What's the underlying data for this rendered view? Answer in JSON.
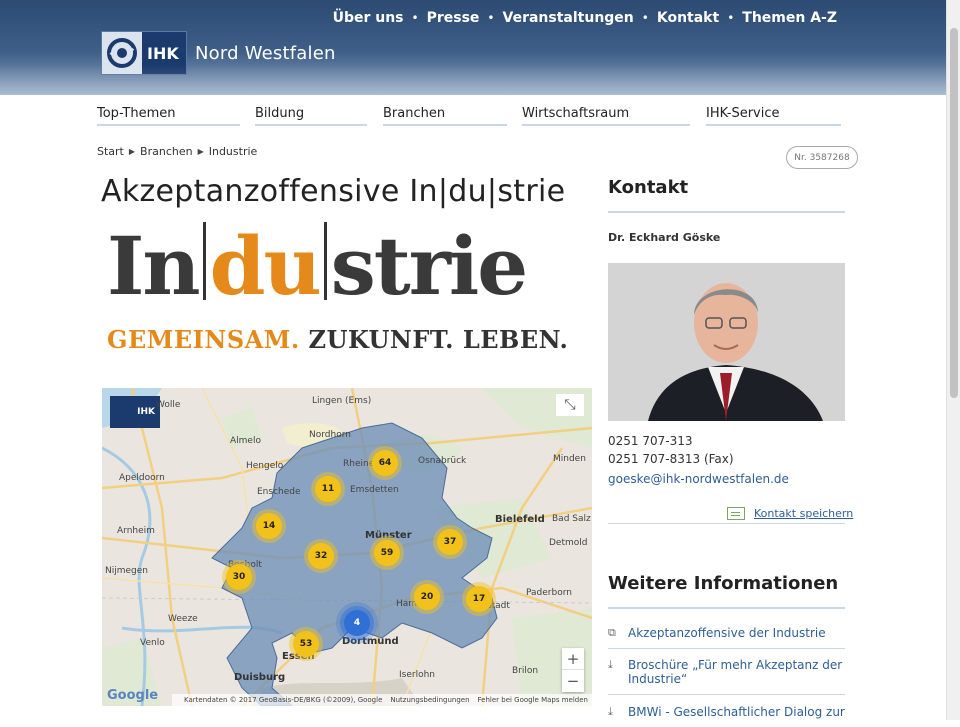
{
  "header": {
    "logo_text": "IHK",
    "org_name": "Nord Westfalen",
    "top_nav": [
      "Über uns",
      "Presse",
      "Veranstaltungen",
      "Kontakt",
      "Themen A-Z"
    ]
  },
  "main_nav": [
    "Top-Themen",
    "Bildung",
    "Branchen",
    "Wirtschaftsraum",
    "IHK-Service"
  ],
  "breadcrumb": [
    "Start",
    "Branchen",
    "Industrie"
  ],
  "page_number": "Nr. 3587268",
  "page_title": "Akzeptanzoffensive In|du|strie",
  "banner": {
    "word_part1": "In",
    "word_part2": "du",
    "word_part3": "strie",
    "slogan_part1": "GEMEINSAM.",
    "slogan_part2": "ZUKUNFT. LEBEN."
  },
  "map": {
    "logo": "IHK",
    "places": [
      "Lingen (Ems)",
      "Nordhorn",
      "Almelo",
      "Hengelo",
      "Apeldoorn",
      "Enschede",
      "Rheine",
      "Osnabrück",
      "Emsdetten",
      "Minden",
      "Arnheim",
      "Bielefeld",
      "Bad Salz",
      "Münster",
      "Nijmegen",
      "Detmold",
      "Bocholt",
      "Hamm",
      "Lippstadt",
      "Paderborn",
      "Dortmund",
      "Essen",
      "Duisburg",
      "Iserlohn",
      "Brilon",
      "Wolle",
      "Weeze",
      "Venlo"
    ],
    "clusters": [
      "64",
      "11",
      "14",
      "32",
      "59",
      "37",
      "30",
      "20",
      "17",
      "4",
      "53"
    ],
    "zoom_in": "+",
    "zoom_out": "−",
    "google": "Google",
    "attribution": [
      "Kartendaten © 2017 GeoBasis-DE/BKG (©2009), Google",
      "Nutzungsbedingungen",
      "Fehler bei Google Maps melden"
    ]
  },
  "contact": {
    "heading": "Kontakt",
    "name": "Dr. Eckhard Göske",
    "phone": "0251 707-313",
    "fax": "0251 707-8313 (Fax)",
    "email": "goeske@ihk-nordwestfalen.de",
    "vcard": "Kontakt speichern"
  },
  "more_info": {
    "heading": "Weitere Informationen",
    "items": [
      {
        "icon": "external-link-icon",
        "label": "Akzeptanzoffensive der Industrie"
      },
      {
        "icon": "download-icon",
        "label": "Broschüre „Für mehr Akzeptanz der Industrie“"
      },
      {
        "icon": "download-icon",
        "label": "BMWi - Gesellschaftlicher Dialog zur"
      }
    ]
  },
  "colors": {
    "header_blue": "#2c4a72",
    "link_blue": "#2d5e98",
    "accent_orange": "#e58a1a",
    "divider": "#c9d7e6",
    "cluster_yellow": "#f2c21b"
  }
}
